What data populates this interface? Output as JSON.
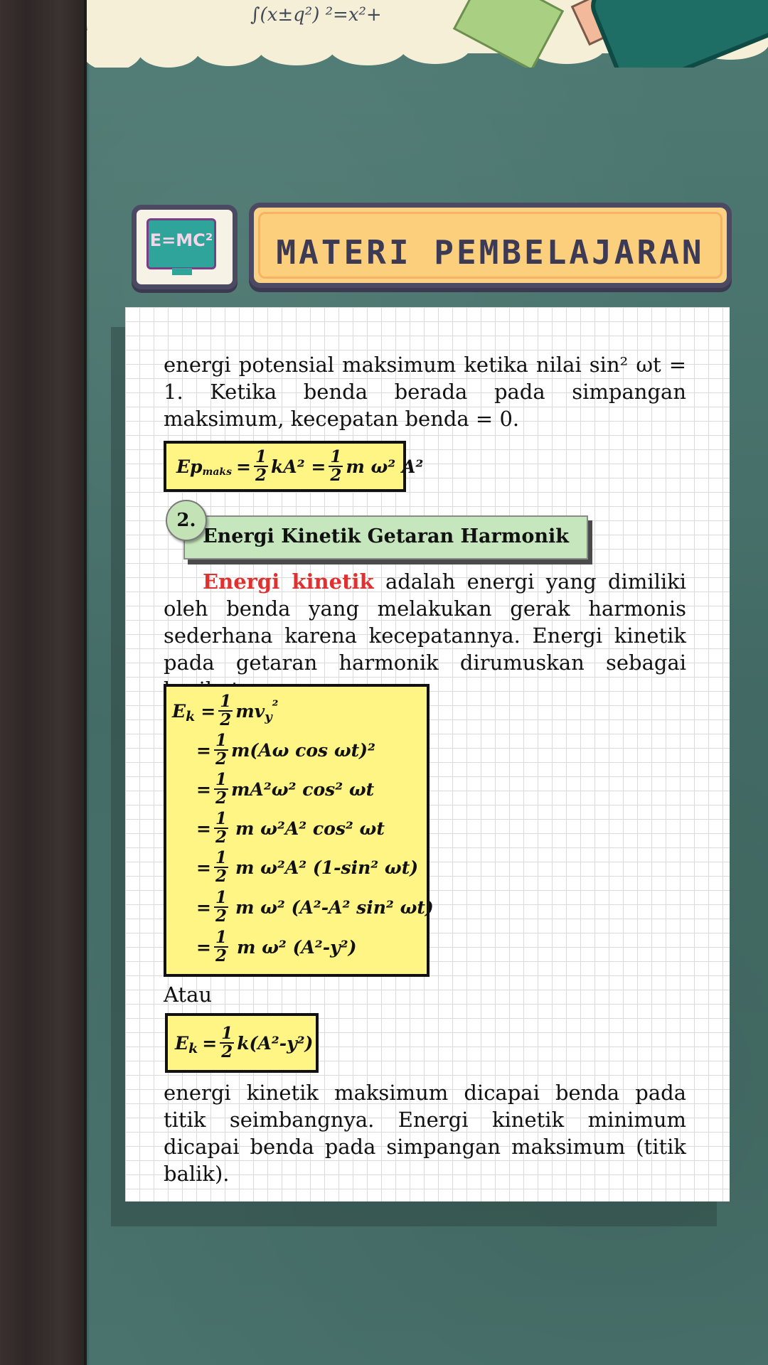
{
  "header": {
    "title": "MATERI PEMBELAJARAN",
    "badge_text": "E=MC²"
  },
  "decoration": {
    "doodle_formula": "∫(x±q²)   ²=x²+"
  },
  "content": {
    "intro_paragraph": "energi potensial maksimum ketika nilai sin² ωt = 1. Ketika benda berada pada simpangan maksimum, kecepatan benda = 0.",
    "ep_formula": {
      "lhs": "Ep",
      "lhs_sub": "maks",
      "eq1": "=",
      "frac1_num": "1",
      "frac1_den": "2",
      "term1": "kA² =",
      "frac2_num": "1",
      "frac2_den": "2",
      "term2": "m ω² A²"
    },
    "section": {
      "number": "2.",
      "title": "Energi Kinetik Getaran Harmonik"
    },
    "kinetic_paragraph": {
      "highlight": "Energi kinetik",
      "rest": " adalah energi yang dimiliki oleh benda yang melakukan gerak harmonis sederhana karena kecepatannya. Energi kinetik pada getaran harmonik dirumuskan sebagai berikut."
    },
    "derivation": {
      "lhs": "E",
      "lhs_sub": "k",
      "eq": "=",
      "frac_num": "1",
      "frac_den": "2",
      "lines": [
        "mv",
        "m(Aω cos ωt)²",
        "mA²ω² cos² ωt",
        "m ω²A² cos² ωt",
        "m ω²A² (1-sin² ωt)",
        "m ω² (A²-A² sin² ωt)",
        "m ω² (A²-y²)"
      ],
      "first_line_sub": "y",
      "first_line_sup": "²"
    },
    "atau": "Atau",
    "ek_formula": {
      "lhs": "E",
      "lhs_sub": "k",
      "eq": "=",
      "frac_num": "1",
      "frac_den": "2",
      "rhs": "k(A²-y²)"
    },
    "closing_paragraph": "energi kinetik maksimum dicapai benda pada titik seimbangnya. Energi kinetik minimum dicapai benda pada simpangan maksimum (titik balik)."
  }
}
